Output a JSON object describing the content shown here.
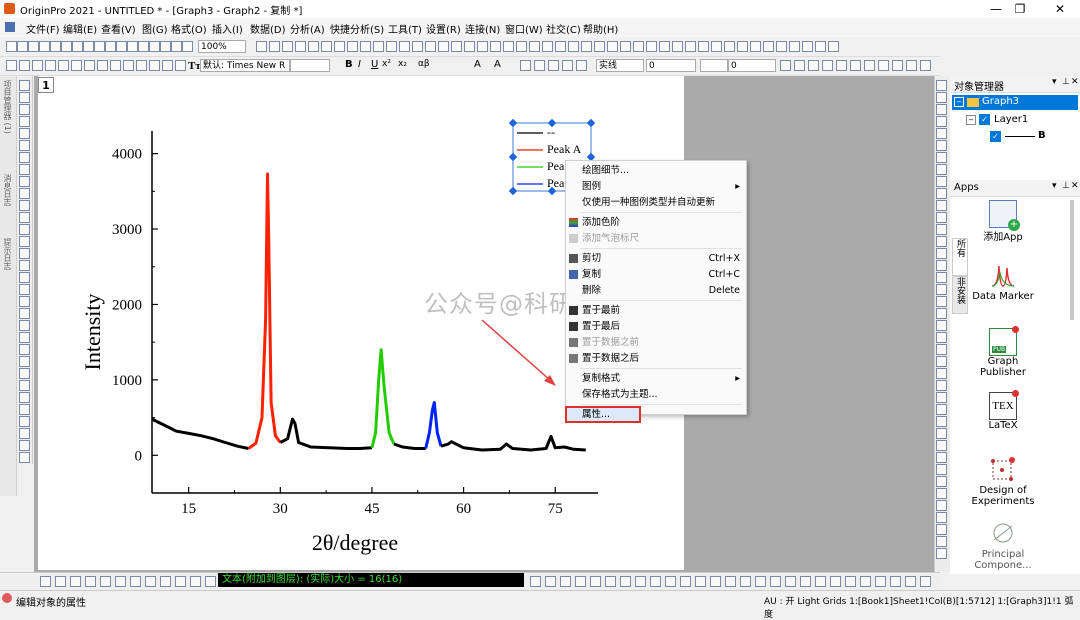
{
  "window": {
    "title": "OriginPro 2021 - UNTITLED * - [Graph3 - Graph2 - 复制 *]",
    "controls": [
      "—",
      "❐",
      "✕"
    ]
  },
  "menu": [
    "文件(F)",
    "编辑(E)",
    "查看(V)",
    "图(G)",
    "格式(O)",
    "插入(I)",
    "数据(D)",
    "分析(A)",
    "快捷分析(S)",
    "工具(T)",
    "设置(R)",
    "连接(N)",
    "窗口(W)",
    "社交(C)",
    "帮助(H)"
  ],
  "toolbar": {
    "zoom": "100%",
    "font": "默认: Times New R",
    "line_style": "实线",
    "line_width": "0",
    "field_a": "0",
    "field_b": "0",
    "format_letters": [
      "B",
      "I",
      "U",
      "x²",
      "x₂",
      "αβ",
      "A",
      "A"
    ]
  },
  "layer_button": "1",
  "chart_data": {
    "type": "line",
    "xlabel": "2θ/degree",
    "ylabel": "Intensity",
    "x_ticks": [
      15,
      30,
      45,
      60,
      75
    ],
    "y_ticks": [
      0,
      1000,
      2000,
      3000,
      4000
    ],
    "xlim": [
      9,
      82
    ],
    "ylim": [
      -500,
      4300
    ],
    "series": [
      {
        "name": "--",
        "color": "#000000",
        "x": [
          9,
          11,
          13,
          15,
          17,
          19,
          21,
          23,
          24.8
        ],
        "y": [
          480,
          400,
          320,
          290,
          260,
          220,
          170,
          120,
          90
        ]
      },
      {
        "name": "Peak A",
        "color": "#ff2200",
        "x": [
          24.8,
          26,
          27,
          27.6,
          27.9,
          28.1,
          28.5,
          29.2,
          30
        ],
        "y": [
          90,
          160,
          500,
          1800,
          3730,
          2900,
          700,
          260,
          170
        ]
      },
      {
        "name": "",
        "color": "#000000",
        "x": [
          30,
          31.2,
          32,
          32.4,
          33,
          35,
          38,
          41,
          43,
          45
        ],
        "y": [
          170,
          220,
          480,
          420,
          170,
          110,
          100,
          90,
          90,
          100
        ]
      },
      {
        "name": "Peak B",
        "color": "#22cc00",
        "x": [
          45,
          45.6,
          46.1,
          46.5,
          47,
          47.8,
          48.6
        ],
        "y": [
          100,
          300,
          1000,
          1400,
          900,
          300,
          150
        ]
      },
      {
        "name": "",
        "color": "#000000",
        "x": [
          48.6,
          50,
          52,
          53.8
        ],
        "y": [
          150,
          110,
          90,
          90
        ]
      },
      {
        "name": "Peak C",
        "color": "#0022ff",
        "x": [
          53.8,
          54.4,
          54.9,
          55.2,
          55.7,
          56.3
        ],
        "y": [
          90,
          300,
          600,
          700,
          300,
          120
        ]
      },
      {
        "name": "",
        "color": "#000000",
        "x": [
          56.3,
          57.5,
          58,
          60,
          63,
          66,
          67,
          68,
          71,
          73.5,
          74.3,
          75,
          76.5,
          78,
          80
        ],
        "y": [
          120,
          150,
          180,
          100,
          70,
          80,
          150,
          90,
          70,
          90,
          250,
          100,
          110,
          80,
          70
        ]
      }
    ]
  },
  "legend": {
    "entries": [
      "--",
      "Peak A",
      "Peak B",
      "Peak C"
    ],
    "display": [
      "--",
      "Peak A",
      "Pea",
      "Pea"
    ]
  },
  "context_menu": {
    "items": [
      {
        "label": "绘图细节...",
        "shortcut": "",
        "enabled": true,
        "submenu": false,
        "icon": ""
      },
      {
        "label": "图例",
        "shortcut": "",
        "enabled": true,
        "submenu": true,
        "icon": ""
      },
      {
        "label": "仅使用一种图例类型并自动更新",
        "shortcut": "",
        "enabled": true,
        "submenu": false,
        "icon": ""
      },
      {
        "label": "添加色阶",
        "shortcut": "",
        "enabled": true,
        "submenu": false,
        "icon": "color-scale"
      },
      {
        "label": "添加气泡标尺",
        "shortcut": "",
        "enabled": false,
        "submenu": false,
        "icon": "bubble"
      },
      {
        "label": "剪切",
        "shortcut": "Ctrl+X",
        "enabled": true,
        "submenu": false,
        "icon": "scissors"
      },
      {
        "label": "复制",
        "shortcut": "Ctrl+C",
        "enabled": true,
        "submenu": false,
        "icon": "copy"
      },
      {
        "label": "删除",
        "shortcut": "Delete",
        "enabled": true,
        "submenu": false,
        "icon": ""
      },
      {
        "label": "置于最前",
        "shortcut": "",
        "enabled": true,
        "submenu": false,
        "icon": "front"
      },
      {
        "label": "置于最后",
        "shortcut": "",
        "enabled": true,
        "submenu": false,
        "icon": "back"
      },
      {
        "label": "置于数据之前",
        "shortcut": "",
        "enabled": false,
        "submenu": false,
        "icon": "square"
      },
      {
        "label": "置于数据之后",
        "shortcut": "",
        "enabled": true,
        "submenu": false,
        "icon": "square"
      },
      {
        "label": "复制格式",
        "shortcut": "",
        "enabled": true,
        "submenu": true,
        "icon": ""
      },
      {
        "label": "保存格式为主题...",
        "shortcut": "",
        "enabled": true,
        "submenu": false,
        "icon": ""
      },
      {
        "label": "属性...",
        "shortcut": "",
        "enabled": true,
        "submenu": false,
        "icon": "",
        "highlighted": true
      }
    ]
  },
  "watermark": "公众号@科研宝典",
  "object_manager": {
    "title": "对象管理器",
    "graph": "Graph3",
    "layer": "Layer1",
    "plot": "B"
  },
  "apps": {
    "title": "Apps",
    "tabs": [
      "所有",
      "非安装"
    ],
    "items": [
      "添加App",
      "Data Marker",
      "Graph Publisher",
      "LaTeX",
      "Design of Experiments",
      "Principal Compone..."
    ]
  },
  "left_dock_labels": [
    "项目管理器 (1)",
    "消息日志",
    "提示日志"
  ],
  "bottom_status_text": "文本(附加到图层): (实际)大小 = 16(16)",
  "status": {
    "left": "编辑对象的属性",
    "right": "AU : 开 Light Grids 1:[Book1]Sheet1!Col(B)[1:5712] 1:[Graph3]1!1 弧度"
  },
  "colors": {
    "accent": "#0078d7",
    "highlight_border": "#e0302a",
    "arrow": "#e04040"
  }
}
